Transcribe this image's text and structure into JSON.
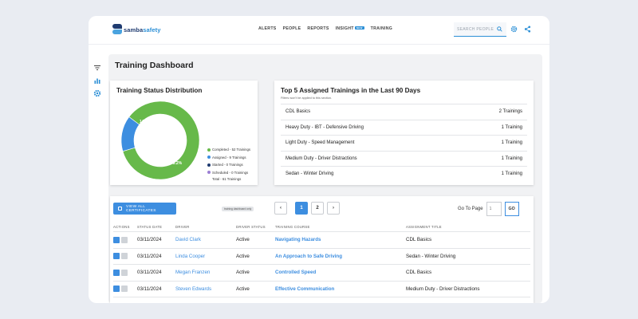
{
  "brand": {
    "prefix": "samba",
    "suffix": "safety"
  },
  "nav": {
    "alerts": "ALERTS",
    "people": "PEOPLE",
    "reports": "REPORTS",
    "insight": "INSIGHT",
    "insight_badge": "NEW",
    "training": "TRAINING"
  },
  "search": {
    "placeholder": "SEARCH PEOPLE"
  },
  "page": {
    "title": "Training Dashboard"
  },
  "status_card": {
    "title": "Training Status Distribution",
    "inner_label_blue": "14.8%",
    "inner_label_green": "85.2%",
    "legend": [
      {
        "label": "Completed - 52 Trainings",
        "color": "#67b94a"
      },
      {
        "label": "Assigned - 9 Trainings",
        "color": "#3d8ee0"
      },
      {
        "label": "Started - 0 Trainings",
        "color": "#1f3b70"
      },
      {
        "label": "Scheduled - 0 Trainings",
        "color": "#9b7fd4"
      }
    ],
    "total": "Total - 61 Trainings"
  },
  "chart_data": {
    "type": "pie",
    "title": "Training Status Distribution",
    "categories": [
      "Completed",
      "Assigned",
      "Started",
      "Scheduled"
    ],
    "values": [
      52,
      9,
      0,
      0
    ],
    "percentages": [
      85.2,
      14.8,
      0,
      0
    ],
    "colors": [
      "#67b94a",
      "#3d8ee0",
      "#1f3b70",
      "#9b7fd4"
    ]
  },
  "top5": {
    "title": "Top 5 Assigned Trainings in the Last 90 Days",
    "subtitle": "Filters won't be applied to this section.",
    "rows": [
      {
        "name": "CDL Basics",
        "count": "2 Trainings"
      },
      {
        "name": "Heavy Duty - IBT - Defensive Driving",
        "count": "1 Training"
      },
      {
        "name": "Light Duty - Speed Management",
        "count": "1 Training"
      },
      {
        "name": "Medium Duty - Driver Distractions",
        "count": "1 Training"
      },
      {
        "name": "Sedan - Winter Driving",
        "count": "1 Training"
      }
    ]
  },
  "table": {
    "cert_button": "VIEW ALL CERTIFICATES",
    "tag": "training dashboard only",
    "pager": {
      "prev": "‹",
      "pages": [
        "1",
        "2"
      ],
      "next": "›"
    },
    "goto": {
      "label": "Go To Page",
      "placeholder": "1",
      "button": "GO"
    },
    "columns": [
      "ACTIONS",
      "STATUS DATE",
      "DRIVER",
      "DRIVER STATUS",
      "TRAINING COURSE",
      "ASSIGNMENT TITLE"
    ],
    "rows": [
      {
        "date": "03/11/2024",
        "driver": "David Clark",
        "status": "Active",
        "course": "Navigating Hazards",
        "title": "CDL Basics"
      },
      {
        "date": "03/11/2024",
        "driver": "Linda Cooper",
        "status": "Active",
        "course": "An Approach to Safe Driving",
        "title": "Sedan - Winter Driving"
      },
      {
        "date": "03/11/2024",
        "driver": "Megan Franzen",
        "status": "Active",
        "course": "Controlled Speed",
        "title": "CDL Basics"
      },
      {
        "date": "03/11/2024",
        "driver": "Steven Edwards",
        "status": "Active",
        "course": "Effective Communication",
        "title": "Medium Duty - Driver Distractions"
      }
    ]
  }
}
